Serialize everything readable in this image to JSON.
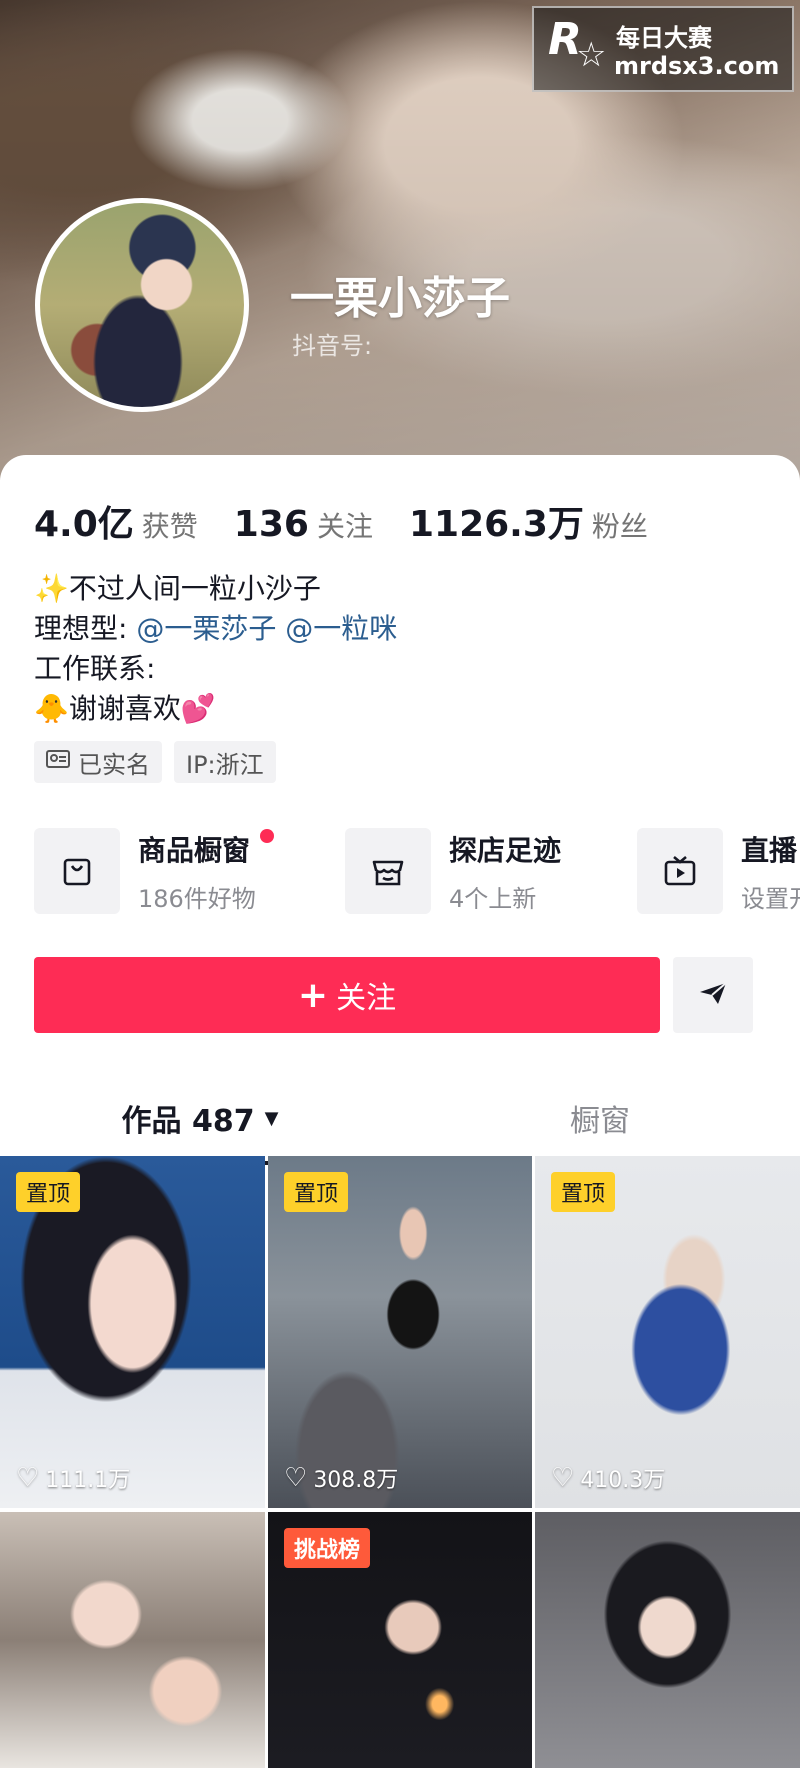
{
  "watermark": {
    "logo_letter": "R",
    "name": "每日大赛",
    "url": "mrdsx3.com"
  },
  "profile": {
    "nickname": "一栗小莎子",
    "douyin_id_label": "抖音号:",
    "stats": [
      {
        "value": "4.0亿",
        "label": "获赞"
      },
      {
        "value": "136",
        "label": "关注"
      },
      {
        "value": "1126.3万",
        "label": "粉丝"
      }
    ],
    "bio": {
      "line1": "✨不过人间一粒小沙子",
      "line2_prefix": "理想型:",
      "mention1": "@一栗莎子",
      "mention2": "@一粒咪",
      "line3": "工作联系:",
      "line4": "🐥谢谢喜欢💕"
    },
    "tags": [
      "已实名",
      "IP:浙江"
    ]
  },
  "features": [
    {
      "title": "商品橱窗",
      "subtitle": "186件好物",
      "icon": "shopping-bag-icon"
    },
    {
      "title": "探店足迹",
      "subtitle": "4个上新",
      "icon": "store-icon"
    },
    {
      "title": "直播",
      "subtitle": "设置开",
      "icon": "tv-play-icon"
    }
  ],
  "actions": {
    "follow_label": "关注",
    "follow_plus": "+"
  },
  "tabs": {
    "works_label": "作品 487",
    "window_label": "橱窗"
  },
  "videos": [
    {
      "badge": "置顶",
      "likes": "111.1万"
    },
    {
      "badge": "置顶",
      "likes": "308.8万"
    },
    {
      "badge": "置顶",
      "likes": "410.3万"
    },
    {
      "badge": "",
      "likes": ""
    },
    {
      "badge": "挑战榜",
      "likes": ""
    },
    {
      "badge": "",
      "likes": ""
    }
  ],
  "colors": {
    "accent": "#fe2c55",
    "pin_badge": "#fed02a",
    "challenge_badge": "#fe5a3a",
    "mention": "#2b5d8f"
  }
}
